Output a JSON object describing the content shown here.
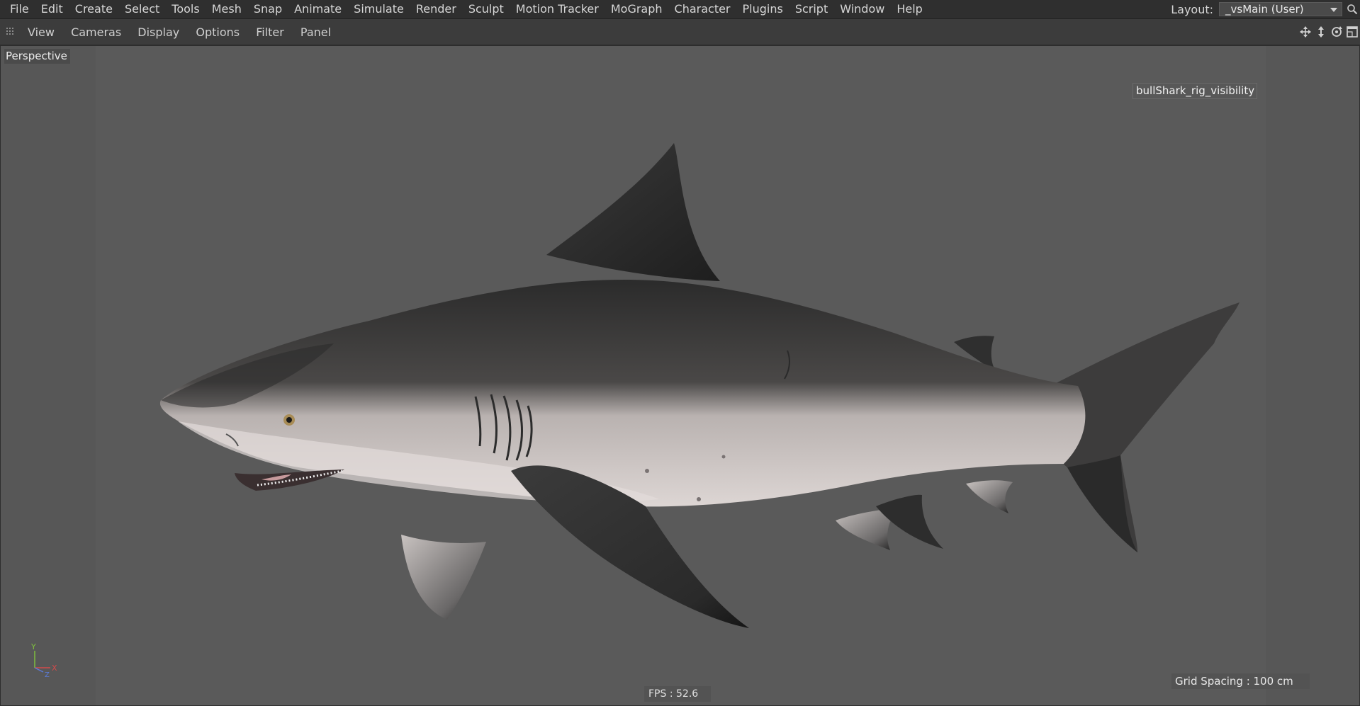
{
  "menubar": {
    "items": [
      "File",
      "Edit",
      "Create",
      "Select",
      "Tools",
      "Mesh",
      "Snap",
      "Animate",
      "Simulate",
      "Render",
      "Sculpt",
      "Motion Tracker",
      "MoGraph",
      "Character",
      "Plugins",
      "Script",
      "Window",
      "Help"
    ],
    "layout_label": "Layout:",
    "layout_value": "_vsMain (User)"
  },
  "viewbar": {
    "items": [
      "View",
      "Cameras",
      "Display",
      "Options",
      "Filter",
      "Panel"
    ]
  },
  "viewport": {
    "camera_label": "Perspective",
    "object_label": "bullShark_rig_visibility",
    "fps_text": "FPS : 52.6",
    "grid_spacing_text": "Grid Spacing : 100 cm",
    "axis_labels": {
      "y": "Y",
      "x": "X",
      "z": "Z"
    }
  },
  "icons": {
    "layout_dropdown": "chevron-down-icon",
    "search": "search-icon",
    "grip": "grip-icon",
    "nav": [
      "move-icon",
      "dolly-icon",
      "rotate-icon",
      "maximize-icon"
    ]
  },
  "colors": {
    "menubar_bg": "#2f2f2f",
    "viewport_bg": "#5a5a5a",
    "axis_y": "#7fbf3f",
    "axis_x": "#d24b4b",
    "axis_z": "#5b7bd6"
  }
}
